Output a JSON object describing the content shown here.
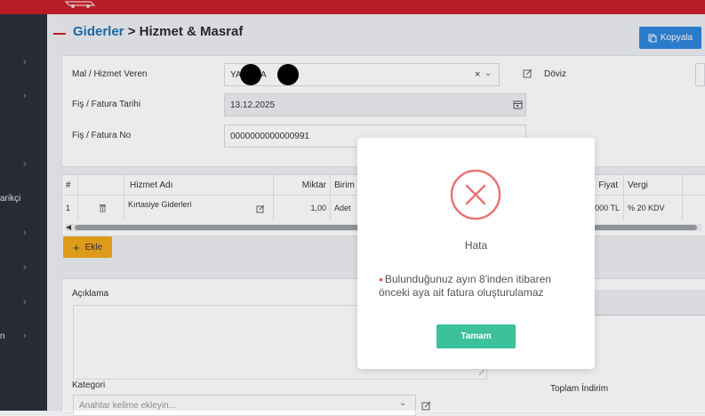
{
  "breadcrumb": {
    "parent": "Giderler",
    "separator": " > ",
    "current": "Hizmet & Masraf"
  },
  "toolbar": {
    "copy_label": "Kopyala"
  },
  "sidebar": {
    "items": [
      {
        "label": "arikçi"
      },
      {
        "label": "n"
      }
    ]
  },
  "form": {
    "supplier_label": "Mal / Hizmet Veren",
    "supplier_value_a": "YA",
    "supplier_value_b": "N A",
    "currency_label": "Döviz",
    "date_label": "Fiş / Fatura Tarihi",
    "date_value": "13.12.2025",
    "number_label": "Fiş / Fatura No",
    "number_value": "0000000000000991"
  },
  "table": {
    "headers": {
      "index": "#",
      "name": "Hizmet Adı",
      "qty": "Miktar",
      "unit": "Birim",
      "price": "Fiyat",
      "tax": "Vergi"
    },
    "rows": [
      {
        "index": "1",
        "name": "Kırtasiye Giderleri",
        "qty": "1,00",
        "unit": "Adet",
        "price": "0000 TL",
        "tax": "% 20 KDV"
      }
    ]
  },
  "add_button_label": "Ekle",
  "details": {
    "description_label": "Açıklama",
    "category_label": "Kategori",
    "category_placeholder": "Anahtar kelime ekleyin...",
    "total_discount_label": "Toplam İndirim"
  },
  "modal": {
    "title": "Hata",
    "message": "Bulunduğunuz ayın 8'inden itibaren önceki aya ait fatura oluşturulamaz",
    "confirm_label": "Tamam"
  },
  "colors": {
    "brand_red": "#c8202a",
    "primary_blue": "#2e86de",
    "add_orange": "#f0a91e",
    "confirm_green": "#3cc19b",
    "error_red": "#e87474"
  }
}
